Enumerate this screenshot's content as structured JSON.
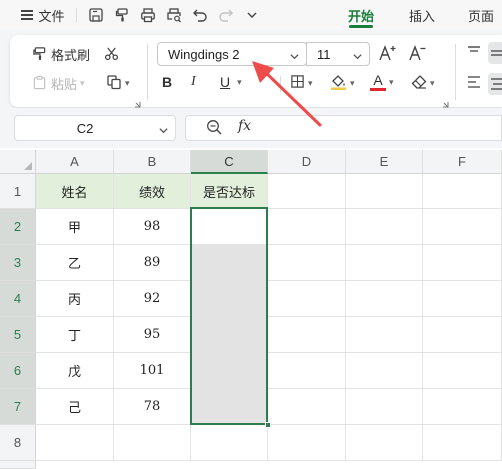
{
  "menu": {
    "file_label": "文件",
    "tabs": [
      {
        "label": "开始",
        "active": true
      },
      {
        "label": "插入",
        "active": false
      },
      {
        "label": "页面",
        "active": false
      }
    ],
    "quick_icons": [
      "save-icon",
      "format-painter-icon",
      "print-icon",
      "print-preview-icon",
      "undo-icon",
      "redo-icon",
      "more-chevron-icon"
    ]
  },
  "ribbon": {
    "format_painter_label": "格式刷",
    "paste_label": "粘贴",
    "font_name": "Wingdings 2",
    "font_size": "11",
    "bold": "B",
    "italic": "I",
    "underline": "U",
    "font_color": "A",
    "font_color_hex": "#e0272f",
    "fill_color_hex": "#f2c94c"
  },
  "formula_bar": {
    "cell_ref": "C2",
    "fx_label": "fx",
    "content": ""
  },
  "sheet": {
    "columns": [
      "A",
      "B",
      "C",
      "D",
      "E",
      "F"
    ],
    "rows": [
      "1",
      "2",
      "3",
      "4",
      "5",
      "6",
      "7",
      "8"
    ],
    "selected_column": "C",
    "header_row": [
      "姓名",
      "绩效",
      "是否达标"
    ],
    "data": [
      [
        "甲",
        "98",
        ""
      ],
      [
        "乙",
        "89",
        ""
      ],
      [
        "丙",
        "92",
        ""
      ],
      [
        "丁",
        "95",
        ""
      ],
      [
        "戊",
        "101",
        ""
      ],
      [
        "己",
        "78",
        ""
      ]
    ],
    "accent_green": "#2e7d4f",
    "header_fill": "#e2efda"
  },
  "annotation": {
    "arrow_color": "#ee4b4b"
  }
}
